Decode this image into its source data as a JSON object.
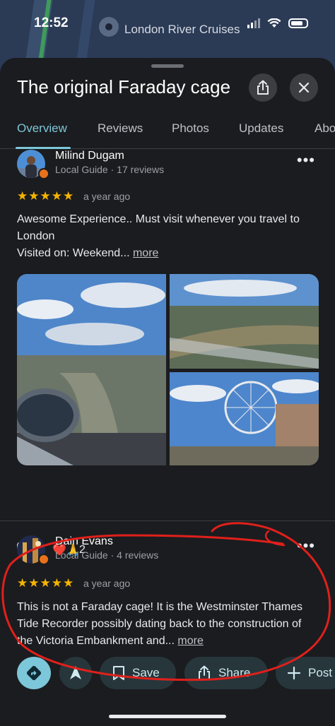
{
  "status_bar": {
    "time": "12:52"
  },
  "map": {
    "place_label": "London River Cruises"
  },
  "header": {
    "title": "The original Faraday cage"
  },
  "tabs": [
    {
      "label": "Overview",
      "active": true
    },
    {
      "label": "Reviews",
      "active": false
    },
    {
      "label": "Photos",
      "active": false
    },
    {
      "label": "Updates",
      "active": false
    },
    {
      "label": "Abo",
      "active": false
    }
  ],
  "reviews": [
    {
      "name": "Milind Dugam",
      "meta": "Local Guide · 17 reviews",
      "stars": "★★★★★",
      "rating": 5,
      "time": "a year ago",
      "text": "Awesome Experience.. Must visit whenever you travel to London",
      "visited_label": "Visited on:",
      "visited_value": "Weekend...",
      "more_label": "more",
      "reactions_emoji": "❤️🙏",
      "reactions_count": "2"
    },
    {
      "name": "Dain Evans",
      "meta": "Local Guide · 4 reviews",
      "stars": "★★★★★",
      "rating": 5,
      "time": "a year ago",
      "text": "This is not a Faraday cage! It is the Westminster Thames Tide Recorder possibly dating back to the construction of the Victoria Embankment and...",
      "more_label": "more"
    }
  ],
  "actions": {
    "save_label": "Save",
    "share_label": "Share",
    "post_label": "Post"
  },
  "colors": {
    "accent": "#7cc7d9",
    "star": "#f5b400",
    "background": "#1b1c1f",
    "annotation": "#e0201b"
  }
}
